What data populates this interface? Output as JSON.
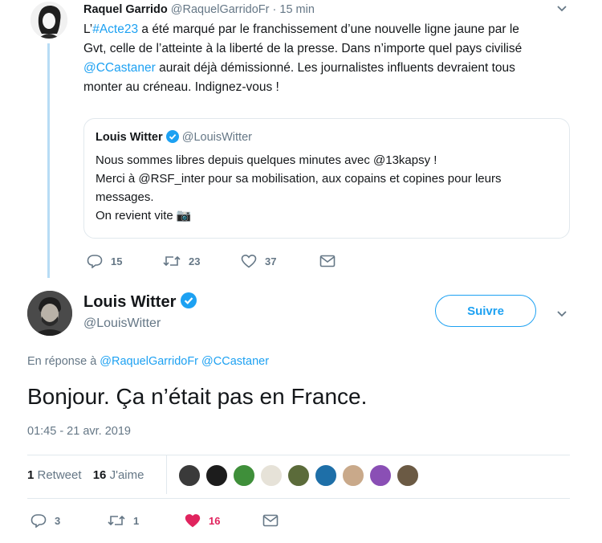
{
  "colors": {
    "accent": "#1da1f2",
    "muted": "#657786",
    "like_red": "#e0245e",
    "thread_line": "#b7dcf5",
    "divider": "#e1e8ed"
  },
  "reply_tweet": {
    "name": "Raquel Garrido",
    "handle": "@RaquelGarridoFr",
    "time": "· 15 min",
    "text_line1_prefix": "L’",
    "text_hashtag": "#Acte23",
    "text_line1_rest": " a été marqué par le franchissement d’une nouvelle ligne jaune par le",
    "text_line2": "Gvt, celle de l’atteinte à la liberté de la presse. Dans n’importe quel pays civilisé",
    "text_mention": "@CCastaner",
    "text_line3_rest": " aurait déjà démissionné. Les journalistes influents devraient tous",
    "text_line4": "monter au créneau. Indignez-vous !",
    "actions": {
      "replies": "15",
      "retweets": "23",
      "likes": "37"
    },
    "quote": {
      "name": "Louis Witter",
      "handle": "@LouisWitter",
      "line1": "Nous sommes libres depuis quelques minutes avec @13kapsy !",
      "line2": "Merci à @RSF_inter pour sa mobilisation, aux copains et copines pour leurs",
      "line3": "messages.",
      "line4": "On revient vite 📷"
    }
  },
  "main_tweet": {
    "name": "Louis Witter",
    "handle": "@LouisWitter",
    "follow_label": "Suivre",
    "reply_prefix": "En réponse à ",
    "reply_mention1": "@RaquelGarridoFr",
    "reply_mention2": " @CCastaner",
    "text": "Bonjour. Ça n’était pas en France.",
    "timestamp": "01:45 - 21 avr. 2019",
    "stats": {
      "retweet_count": "1",
      "retweet_label": " Retweet",
      "like_count": "16",
      "like_label": " J'aime"
    },
    "actions": {
      "replies": "3",
      "retweets": "1",
      "likes": "16"
    }
  },
  "likers": [
    {
      "color": "#3a3a3a"
    },
    {
      "color": "#1c1c1c"
    },
    {
      "color": "#3f8f3a"
    },
    {
      "color": "#e6e2d8"
    },
    {
      "color": "#5b6b3a"
    },
    {
      "color": "#1e6fa8"
    },
    {
      "color": "#c9a98a"
    },
    {
      "color": "#8a4fb5"
    },
    {
      "color": "#6b5a44"
    }
  ]
}
